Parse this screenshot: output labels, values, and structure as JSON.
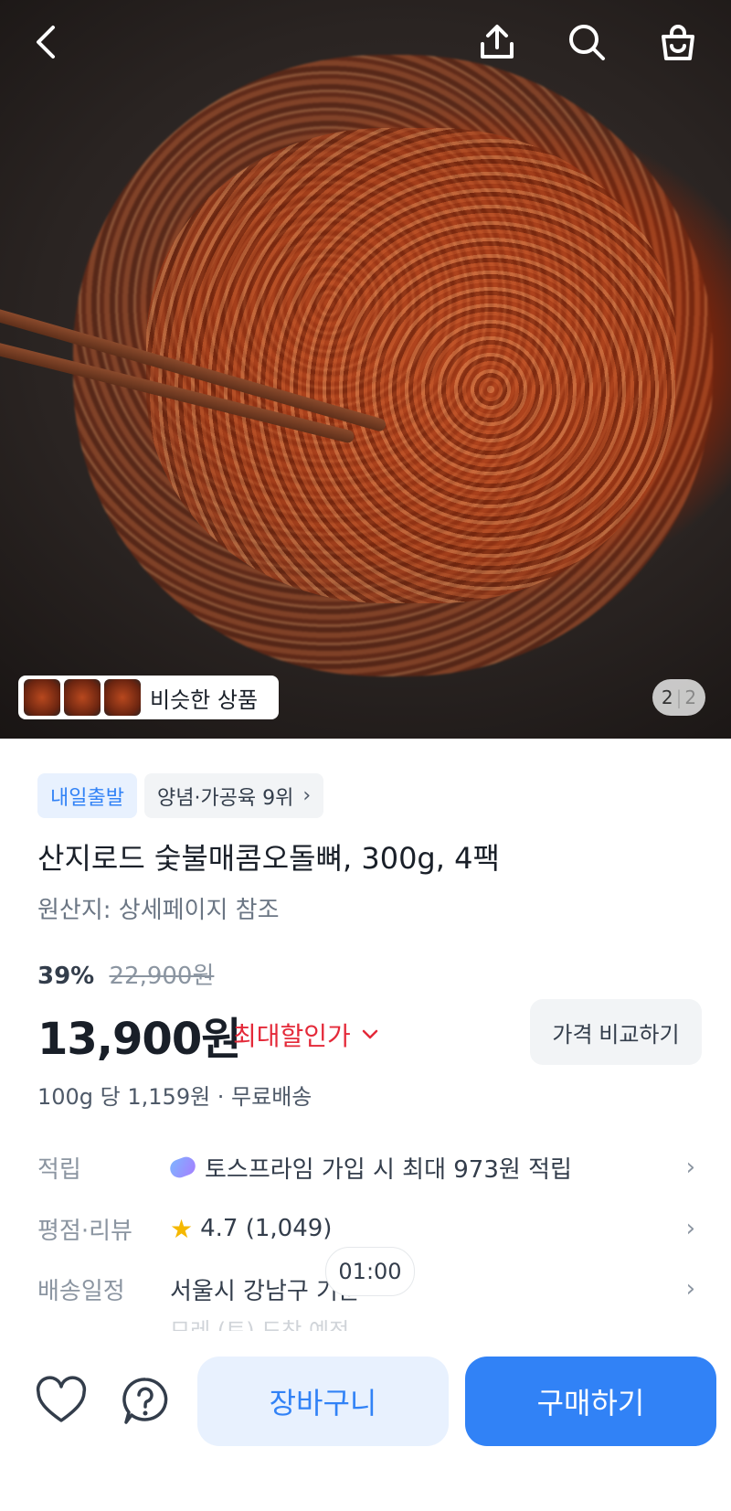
{
  "hero": {
    "similar_label": "비슷한 상품",
    "pager_current": "2",
    "pager_sep": "|",
    "pager_total": "2"
  },
  "header_icons": [
    "back-icon",
    "share-icon",
    "search-icon",
    "cart-icon"
  ],
  "product": {
    "tags": [
      {
        "label": "내일출발",
        "style": "blue"
      },
      {
        "label": "양념·가공육 9위",
        "style": "gray",
        "chevron": ">"
      }
    ],
    "title": "산지로드 숯불매콤오돌뼈, 300g, 4팩",
    "origin": "원산지: 상세페이지 참조",
    "discount_rate": "39%",
    "original_price": "22,900원",
    "price": "13,900원",
    "max_discount_label": "최대할인가",
    "compare_label": "가격 비교하기",
    "unit_price": "100g 당 1,159원 · 무료배송"
  },
  "info_rows": [
    {
      "label": "적립",
      "value": "토스프라임 가입 시 최대 973원 적립"
    },
    {
      "label": "평점·리뷰",
      "value": "4.7 (1,049)"
    },
    {
      "label": "배송일정",
      "value": "서울시 강남구 기준"
    }
  ],
  "delivery_faded": "모레 (토) 도착 예정",
  "timer": "01:00",
  "bottom": {
    "cart_label": "장바구니",
    "buy_label": "구매하기"
  },
  "colors": {
    "accent": "#3182f6",
    "accent_light": "#e8f1fe",
    "sale_red": "#e42939"
  }
}
